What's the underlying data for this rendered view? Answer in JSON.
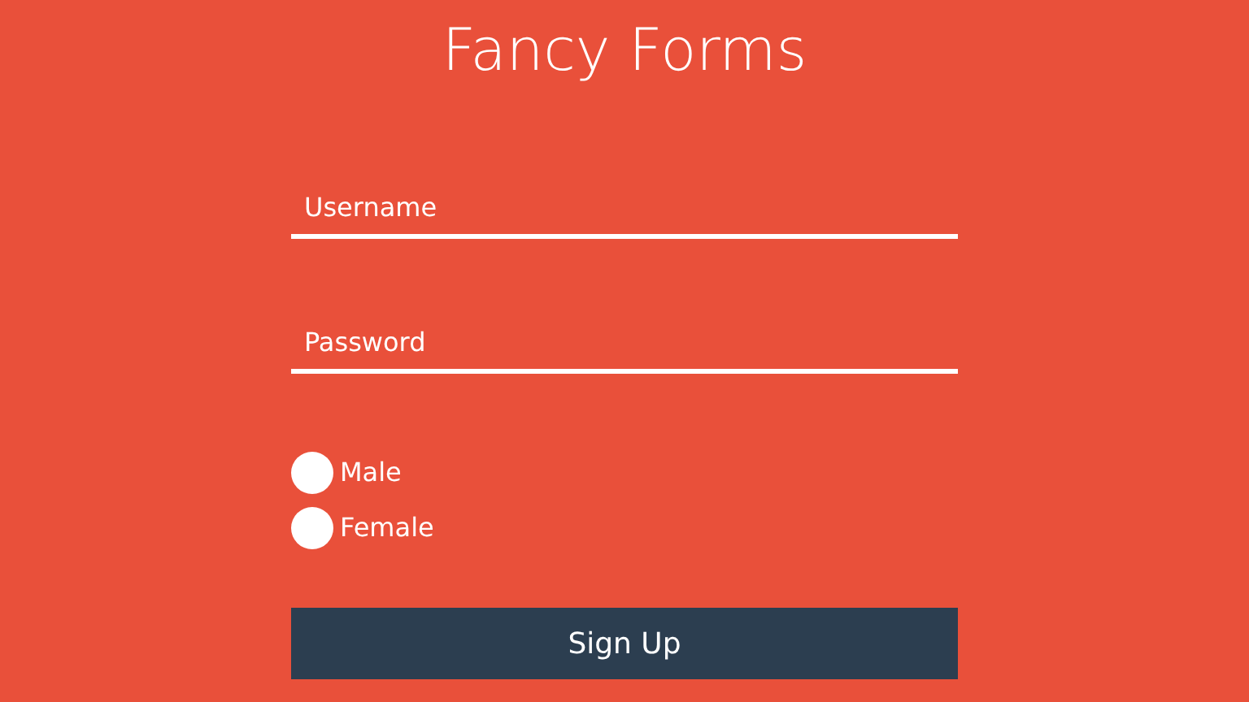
{
  "title": "Fancy Forms",
  "fields": [
    {
      "placeholder": "Username"
    },
    {
      "placeholder": "Password"
    }
  ],
  "gender": [
    {
      "label": "Male",
      "selected": false
    },
    {
      "label": "Female",
      "selected": false
    }
  ],
  "submit": "Sign Up"
}
